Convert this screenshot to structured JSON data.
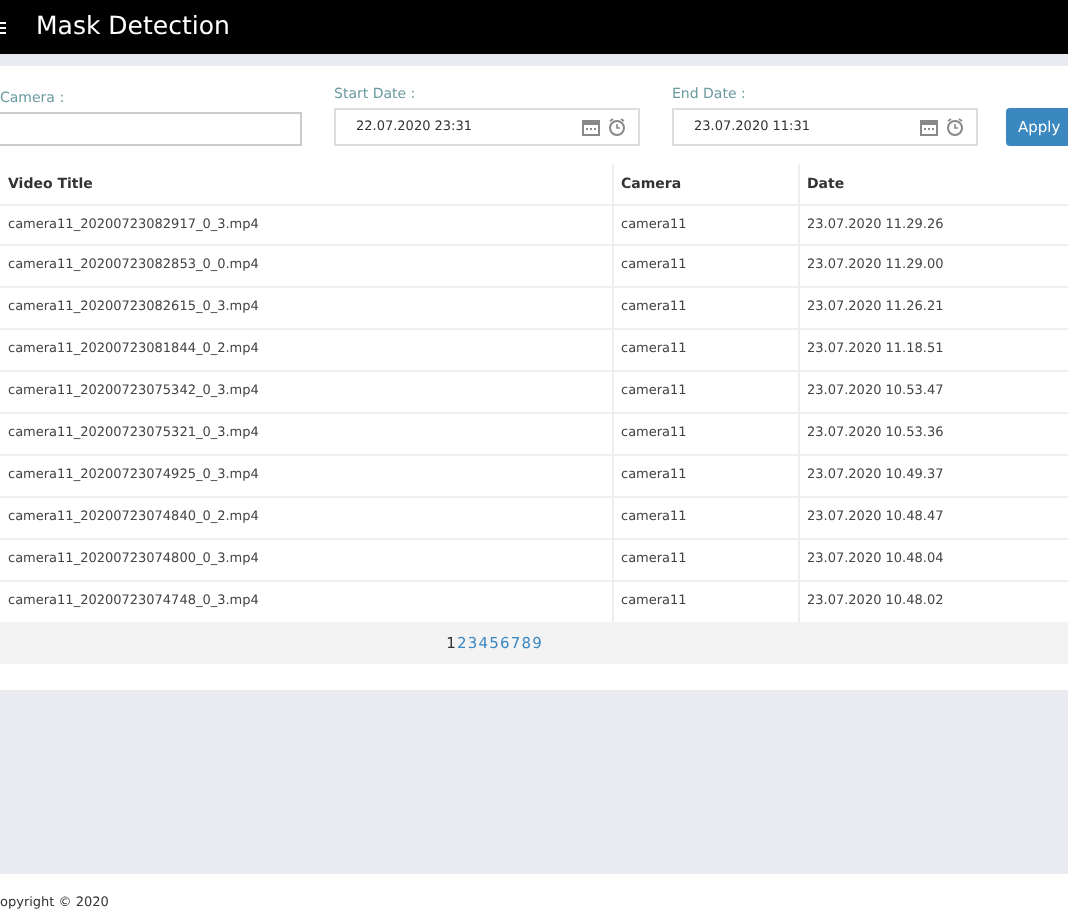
{
  "header": {
    "title": "Mask Detection"
  },
  "filters": {
    "camera": {
      "label": "Camera :"
    },
    "start_date": {
      "label": "Start Date :",
      "value": "22.07.2020 23:31"
    },
    "end_date": {
      "label": "End Date :",
      "value": "23.07.2020 11:31"
    },
    "apply_button": "Apply"
  },
  "table": {
    "columns": [
      "Video Title",
      "Camera",
      "Date"
    ],
    "rows": [
      [
        "camera11_20200723082917_0_3.mp4",
        "camera11",
        "23.07.2020 11.29.26"
      ],
      [
        "camera11_20200723082853_0_0.mp4",
        "camera11",
        "23.07.2020 11.29.00"
      ],
      [
        "camera11_20200723082615_0_3.mp4",
        "camera11",
        "23.07.2020 11.26.21"
      ],
      [
        "camera11_20200723081844_0_2.mp4",
        "camera11",
        "23.07.2020 11.18.51"
      ],
      [
        "camera11_20200723075342_0_3.mp4",
        "camera11",
        "23.07.2020 10.53.47"
      ],
      [
        "camera11_20200723075321_0_3.mp4",
        "camera11",
        "23.07.2020 10.53.36"
      ],
      [
        "camera11_20200723074925_0_3.mp4",
        "camera11",
        "23.07.2020 10.49.37"
      ],
      [
        "camera11_20200723074840_0_2.mp4",
        "camera11",
        "23.07.2020 10.48.47"
      ],
      [
        "camera11_20200723074800_0_3.mp4",
        "camera11",
        "23.07.2020 10.48.04"
      ],
      [
        "camera11_20200723074748_0_3.mp4",
        "camera11",
        "23.07.2020 10.48.02"
      ]
    ]
  },
  "pagination": [
    {
      "label": "1",
      "selected": true
    },
    {
      "label": "2",
      "selected": false
    },
    {
      "label": "3",
      "selected": false
    },
    {
      "label": "4",
      "selected": false
    },
    {
      "label": "5",
      "selected": false
    },
    {
      "label": "6",
      "selected": false
    },
    {
      "label": "7",
      "selected": false
    },
    {
      "label": "8",
      "selected": false
    },
    {
      "label": "9",
      "selected": false
    }
  ],
  "footer": {
    "copyright": "opyright © 2020"
  }
}
